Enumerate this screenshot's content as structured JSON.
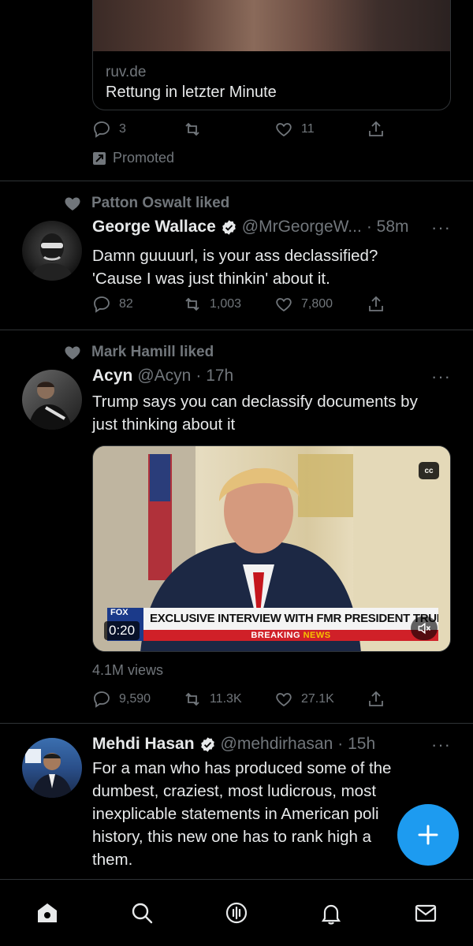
{
  "promo": {
    "card_domain": "ruv.de",
    "card_title": "Rettung in letzter Minute",
    "actions": {
      "replies": "3",
      "retweets": "",
      "likes": "11"
    },
    "promoted_label": "Promoted"
  },
  "tweets": [
    {
      "social_context": "Patton Oswalt liked",
      "name": "George Wallace",
      "verified": true,
      "handle": "@MrGeorgeW...",
      "time": "· 58m",
      "more": "···",
      "text_lines": [
        "Damn guuuurl, is your ass declassified?",
        "'Cause I was just thinkin' about it."
      ],
      "replies": "82",
      "retweets": "1,003",
      "likes": "7,800"
    },
    {
      "social_context": "Mark Hamill liked",
      "name": "Acyn",
      "verified": false,
      "handle": "@Acyn",
      "time": "· 17h",
      "more": "···",
      "text_lines": [
        "Trump says you can declassify documents by",
        "just thinking about it"
      ],
      "media": {
        "cc_label": "cc",
        "network_logo": "FOX",
        "duration": "0:20",
        "chyron": "EXCLUSIVE INTERVIEW WITH FMR PRESIDENT TRUMP",
        "breaking": "BREAKING",
        "news": "NEWS"
      },
      "views": "4.1M views",
      "replies": "9,590",
      "retweets": "11.3K",
      "likes": "27.1K"
    },
    {
      "name": "Mehdi Hasan",
      "verified": true,
      "handle": "@mehdirhasan",
      "time": "· 15h",
      "more": "···",
      "text_lines": [
        "For a man who has produced some of the",
        "dumbest, craziest, most ludicrous, most",
        "inexplicable statements in American poli",
        "history, this new one has to rank high a",
        "them."
      ]
    }
  ],
  "nav": [
    "home-icon",
    "search-icon",
    "spaces-icon",
    "notifications-icon",
    "messages-icon"
  ],
  "fab": {
    "label": "+",
    "color": "#1d9bf0"
  },
  "colors": {
    "background": "#000000",
    "text": "#e7e9ea",
    "muted": "#71767b",
    "divider": "#2f3336",
    "accent": "#1d9bf0"
  }
}
